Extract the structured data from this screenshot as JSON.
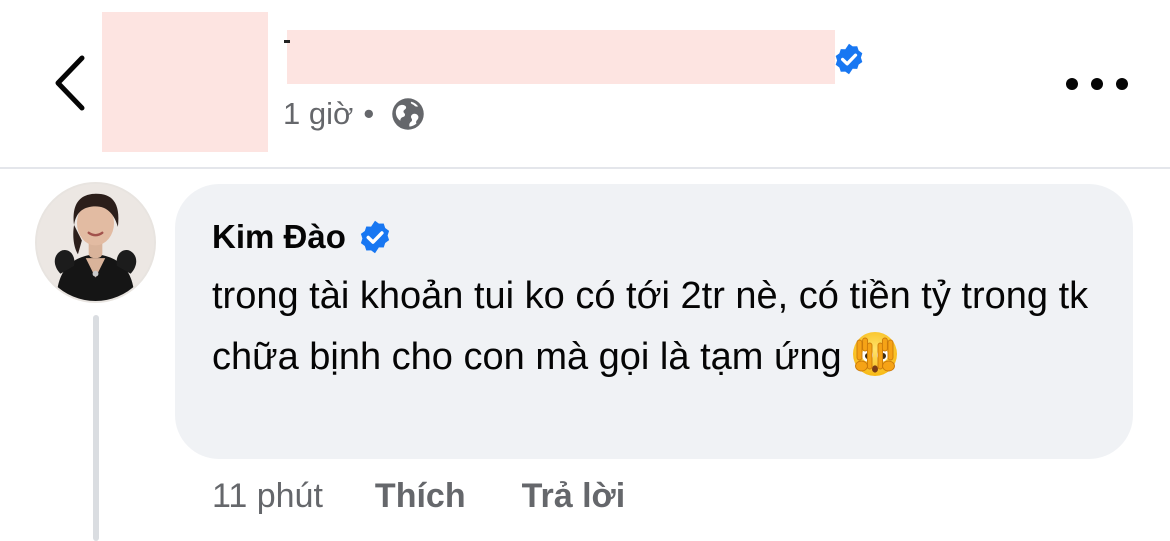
{
  "header": {
    "time": "1 giờ",
    "separator": "•",
    "audience_icon": "globe-icon",
    "back_icon": "chevron-left-icon",
    "more_icon": "more-horizontal-icon",
    "verified_icon": "verified-badge-icon"
  },
  "comment": {
    "author": "Kim Đào",
    "verified_icon": "verified-badge-icon",
    "text": "trong tài khoản tui ko có tới 2tr nè, có tiền tỷ trong tk chữa bịnh cho con mà gọi là tạm ứng",
    "emoji_icon": "face-with-peeking-eye-emoji",
    "time": "11 phút",
    "like_label": "Thích",
    "reply_label": "Trả lời"
  },
  "colors": {
    "verified_blue": "#1877f2",
    "secondary_text": "#65676b",
    "bubble_bg": "#f0f2f5",
    "redaction": "#fde4e1"
  }
}
